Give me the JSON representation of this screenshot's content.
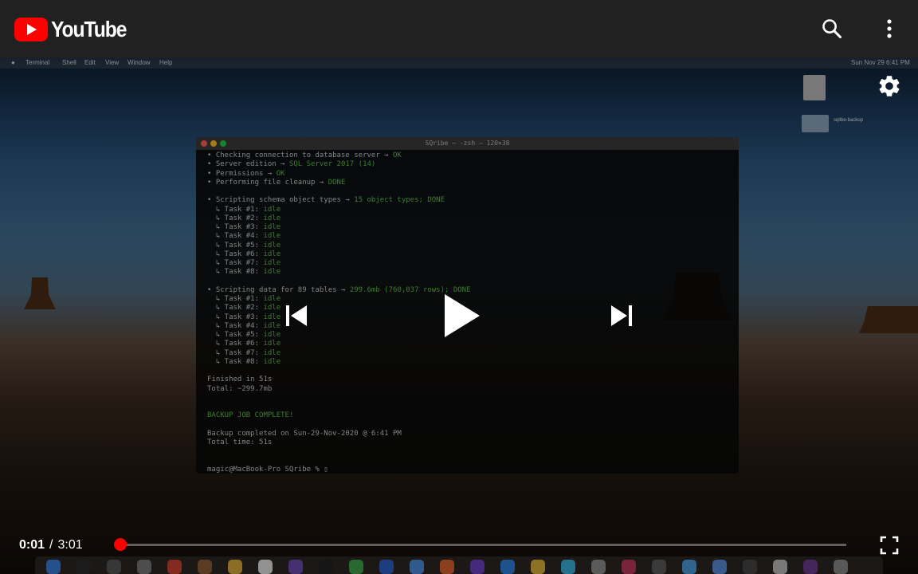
{
  "header": {
    "logo_text": "YouTube",
    "search_icon": "search-icon",
    "more_icon": "more-vert-icon"
  },
  "video": {
    "mac_menu": [
      "Terminal",
      "Shell",
      "Edit",
      "View",
      "Window",
      "Help"
    ],
    "mac_status": "Sun Nov 29 6:41 PM",
    "desktop_items": [
      "sqlibe-backup"
    ],
    "terminal": {
      "title": "SQribe — -zsh — 120×38",
      "lines": [
        {
          "text": "• Checking connection to database server → ",
          "hl": "OK"
        },
        {
          "text": "• Server edition → ",
          "hl": "SQL Server 2017 (14)"
        },
        {
          "text": "• Permissions → ",
          "hl": "OK"
        },
        {
          "text": "• Performing file cleanup → ",
          "hl": "DONE"
        },
        {
          "text": "",
          "hl": ""
        },
        {
          "text": "• Scripting schema object types → ",
          "hl": "15 object types; DONE"
        },
        {
          "text": "  ↳ Task #1: ",
          "hl": "idle"
        },
        {
          "text": "  ↳ Task #2: ",
          "hl": "idle"
        },
        {
          "text": "  ↳ Task #3: ",
          "hl": "idle"
        },
        {
          "text": "  ↳ Task #4: ",
          "hl": "idle"
        },
        {
          "text": "  ↳ Task #5: ",
          "hl": "idle"
        },
        {
          "text": "  ↳ Task #6: ",
          "hl": "idle"
        },
        {
          "text": "  ↳ Task #7: ",
          "hl": "idle"
        },
        {
          "text": "  ↳ Task #8: ",
          "hl": "idle"
        },
        {
          "text": "",
          "hl": ""
        },
        {
          "text": "• Scripting data for 89 tables → ",
          "hl": "299.6mb (760,037 rows); DONE"
        },
        {
          "text": "  ↳ Task #1: ",
          "hl": "idle"
        },
        {
          "text": "  ↳ Task #2: ",
          "hl": "idle"
        },
        {
          "text": "  ↳ Task #3: ",
          "hl": "idle"
        },
        {
          "text": "  ↳ Task #4: ",
          "hl": "idle"
        },
        {
          "text": "  ↳ Task #5: ",
          "hl": "idle"
        },
        {
          "text": "  ↳ Task #6: ",
          "hl": "idle"
        },
        {
          "text": "  ↳ Task #7: ",
          "hl": "idle"
        },
        {
          "text": "  ↳ Task #8: ",
          "hl": "idle"
        },
        {
          "text": "",
          "hl": ""
        },
        {
          "text": "Finished in 51s",
          "hl": ""
        },
        {
          "text": "Total: ~299.7mb",
          "hl": ""
        },
        {
          "text": "",
          "hl": ""
        },
        {
          "text": "",
          "hl": ""
        },
        {
          "text": "",
          "hl": "BACKUP JOB COMPLETE!"
        },
        {
          "text": "",
          "hl": ""
        },
        {
          "text": "Backup completed on Sun-29-Nov-2020 @ 6:41 PM",
          "hl": ""
        },
        {
          "text": "Total time: 51s",
          "hl": ""
        },
        {
          "text": "",
          "hl": ""
        },
        {
          "text": "",
          "hl": ""
        },
        {
          "text": "magic@MacBook-Pro SQribe % ▯",
          "hl": ""
        }
      ]
    }
  },
  "controls": {
    "current_time": "0:01",
    "separator": "/",
    "duration": "3:01",
    "progress_fraction": 0.0055,
    "icons": {
      "prev": "skip-previous-icon",
      "play": "play-icon",
      "next": "skip-next-icon",
      "settings": "gear-icon",
      "fullscreen": "fullscreen-icon"
    }
  },
  "colors": {
    "header_bg": "#212121",
    "brand_red": "#ff0000",
    "terminal_green": "#5fbf4a"
  }
}
